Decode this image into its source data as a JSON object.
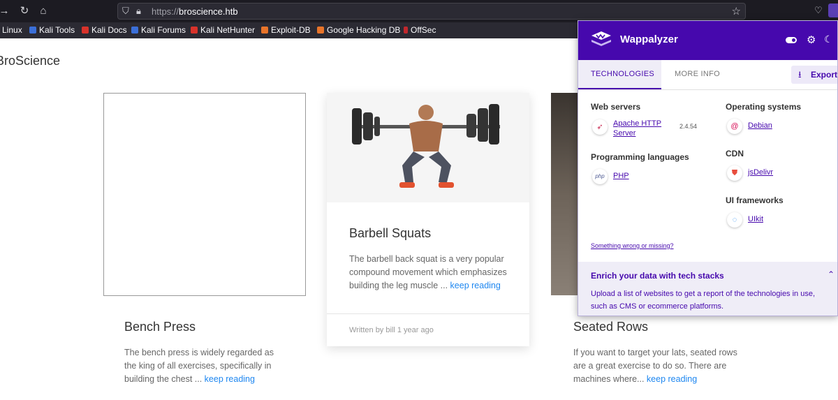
{
  "browser": {
    "url_prefix": "https://",
    "url_host": "broscience.htb",
    "bookmarks": [
      "i Linux",
      "Kali Tools",
      "Kali Docs",
      "Kali Forums",
      "Kali NetHunter",
      "Exploit-DB",
      "Google Hacking DB",
      "OffSec"
    ]
  },
  "site": {
    "title": "BroScience",
    "cards": [
      {
        "title": "Bench Press",
        "text": "The bench press is widely regarded as the king of all exercises, specifically in building the chest ...",
        "link": "keep reading"
      },
      {
        "title": "Barbell Squats",
        "text": "The barbell back squat is a very popular compound movement which emphasizes building the leg muscle ...",
        "link": "keep reading",
        "footer": "Written by bill 1 year ago"
      },
      {
        "title": "Seated Rows",
        "text": "If you want to target your lats, seated rows are a great exercise to do so. There are machines where...",
        "link": "keep reading"
      }
    ]
  },
  "wappalyzer": {
    "name": "Wappalyzer",
    "tabs": {
      "technologies": "TECHNOLOGIES",
      "more_info": "MORE INFO"
    },
    "export": "Export",
    "categories": {
      "web_servers": "Web servers",
      "programming_languages": "Programming languages",
      "operating_systems": "Operating systems",
      "cdn": "CDN",
      "ui_frameworks": "UI frameworks"
    },
    "tech": {
      "apache": {
        "name": "Apache HTTP Server",
        "version": "2.4.54"
      },
      "php": {
        "name": "PHP",
        "icon_text": "php"
      },
      "debian": {
        "name": "Debian"
      },
      "jsdelivr": {
        "name": "jsDelivr"
      },
      "uikit": {
        "name": "UIkit"
      }
    },
    "wrong_link": "Something wrong or missing?",
    "enrich": {
      "title": "Enrich your data with tech stacks",
      "text": "Upload a list of websites to get a report of the technologies in use, such as CMS or ecommerce platforms."
    }
  }
}
